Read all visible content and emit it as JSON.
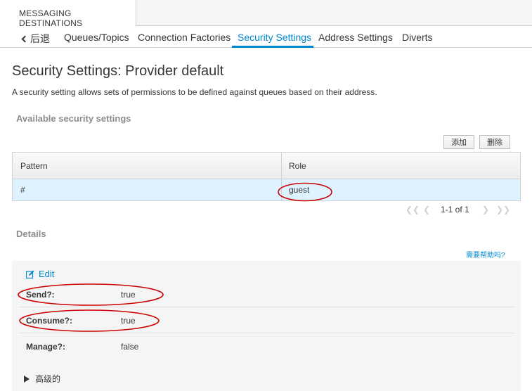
{
  "header": {
    "tab_label": "MESSAGING DESTINATIONS"
  },
  "subnav": {
    "back_label": "后退",
    "items": [
      "Queues/Topics",
      "Connection Factories",
      "Security Settings",
      "Address Settings",
      "Diverts"
    ],
    "active_index": 2
  },
  "page": {
    "title": "Security Settings: Provider default",
    "description": "A security setting allows sets of permissions to be defined against queues based on their address."
  },
  "available": {
    "heading": "Available security settings",
    "add_label": "添加",
    "remove_label": "删除",
    "columns": [
      "Pattern",
      "Role"
    ],
    "rows": [
      {
        "pattern": "#",
        "role": "guest"
      }
    ],
    "pager_text": "1-1 of 1"
  },
  "details": {
    "heading": "Details",
    "help_link": "需要帮助吗?",
    "edit_label": "Edit",
    "fields": [
      {
        "label": "Send?:",
        "value": "true"
      },
      {
        "label": "Consume?:",
        "value": "true"
      },
      {
        "label": "Manage?:",
        "value": "false"
      }
    ],
    "advanced_label": "高级的"
  },
  "colors": {
    "accent": "#0088ce",
    "selected_row": "#def3ff",
    "annotation": "#cc0000"
  }
}
